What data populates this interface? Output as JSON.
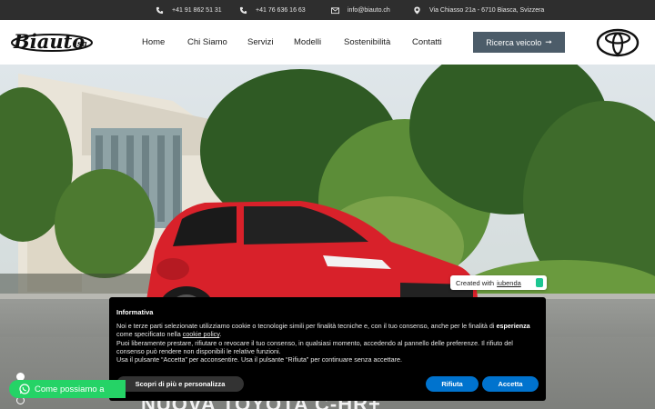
{
  "topbar": {
    "phone1": "+41 91 862 51 31",
    "phone2": "+41 76 636 16 63",
    "email": "info@biauto.ch",
    "address": "Via Chiasso 21a - 6710 Biasca, Svizzera"
  },
  "logo": {
    "text": "Biauto",
    "suffix": "sa"
  },
  "nav": {
    "items": [
      "Home",
      "Chi Siamo",
      "Servizi",
      "Modelli",
      "Sostenibilità",
      "Contatti"
    ],
    "cta_label": "Ricerca veicolo",
    "cta_arrow": "➞"
  },
  "slider": {
    "slide_count": 3,
    "active_index": 0
  },
  "iubenda_badge": {
    "prefix": "Created with",
    "link": "iubenda"
  },
  "cookie_banner": {
    "title": "Informativa",
    "line1_a": "Noi e terze parti selezionate utilizziamo cookie o tecnologie simili per finalità tecniche e, con il tuo consenso, anche per le finalità di",
    "line1_bold": "esperienza",
    "line1_b": "come specificato nella",
    "line1_link": "cookie policy",
    "line1_end": ".",
    "line2": "Puoi liberamente prestare, rifiutare o revocare il tuo consenso, in qualsiasi momento, accedendo al pannello delle preferenze. Il rifiuto del consenso può rendere non disponibili le relative funzioni.",
    "line3": "Usa il pulsante “Accetta” per acconsentire. Usa il pulsante “Rifiuta” per continuare senza accettare.",
    "btn_more": "Scopri di più e personalizza",
    "btn_reject": "Rifiuta",
    "btn_accept": "Accetta"
  },
  "whatsapp": {
    "label": "Come possiamo a"
  },
  "hero": {
    "headline_partial": "NUOVA TOYOTA C-HR+"
  },
  "colors": {
    "topbar_bg": "#2e2e2e",
    "cta_bg": "#4c5c69",
    "cookie_bg": "#000000",
    "cookie_btn_blue": "#0073ce",
    "whatsapp_green": "#25d366",
    "car_red": "#d8212a"
  },
  "icons": [
    "phone-icon",
    "mobile-icon",
    "mail-icon",
    "location-pin-icon",
    "arrow-right-icon",
    "whatsapp-icon",
    "toyota-logo-icon"
  ]
}
